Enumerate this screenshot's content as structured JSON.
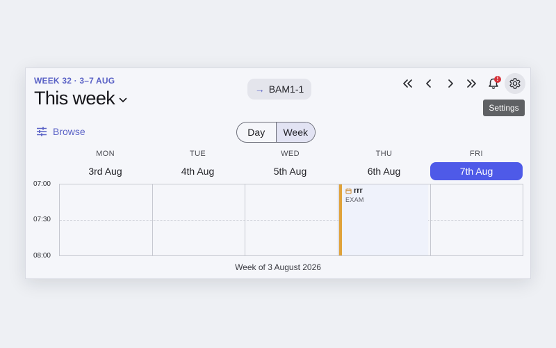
{
  "header": {
    "week_label": "WEEK 32 · 3–7 AUG",
    "title": "This week",
    "room": {
      "arrow": "→",
      "name": "BAM1-1"
    },
    "notification_badge": "!",
    "tooltip": "Settings"
  },
  "toolbar": {
    "browse_label": "Browse",
    "view_options": [
      "Day",
      "Week"
    ],
    "active_view": "Week"
  },
  "days": [
    {
      "name": "MON",
      "date": "3rd Aug",
      "today": false
    },
    {
      "name": "TUE",
      "date": "4th Aug",
      "today": false
    },
    {
      "name": "WED",
      "date": "5th Aug",
      "today": false
    },
    {
      "name": "THU",
      "date": "6th Aug",
      "today": false
    },
    {
      "name": "FRI",
      "date": "7th Aug",
      "today": true
    }
  ],
  "times": [
    "07:00",
    "07:30",
    "08:00"
  ],
  "event": {
    "day": "THU",
    "title": "rrr",
    "subtitle": "EXAM",
    "accent": "#e0a23a"
  },
  "footer": "Week of 3 August 2026",
  "colors": {
    "accent": "#5a62c6",
    "today": "#4e5ae8",
    "badge": "#d6333b"
  }
}
